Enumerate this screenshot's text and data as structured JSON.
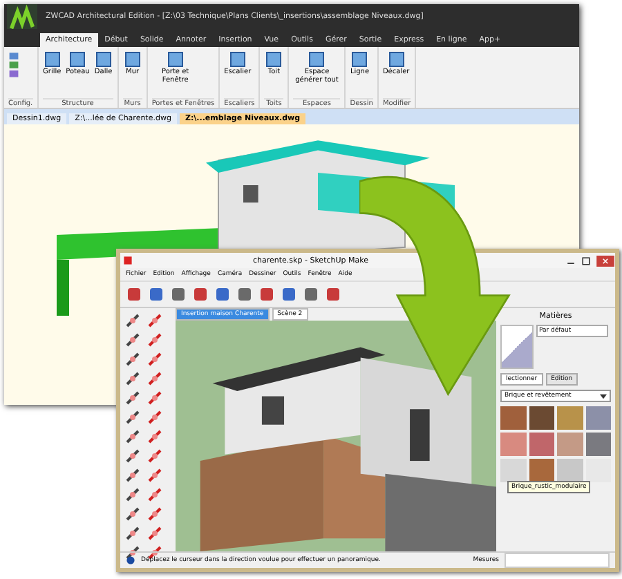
{
  "cad_window": {
    "title": "ZWCAD Architectural Edition - [Z:\\03 Technique\\Plans Clients\\_insertions\\assemblage Niveaux.dwg]",
    "tabs": [
      {
        "label": "Architecture",
        "selected": true
      },
      {
        "label": "Début",
        "selected": false
      },
      {
        "label": "Solide",
        "selected": false
      },
      {
        "label": "Annoter",
        "selected": false
      },
      {
        "label": "Insertion",
        "selected": false
      },
      {
        "label": "Vue",
        "selected": false
      },
      {
        "label": "Outils",
        "selected": false
      },
      {
        "label": "Gérer",
        "selected": false
      },
      {
        "label": "Sortie",
        "selected": false
      },
      {
        "label": "Express",
        "selected": false
      },
      {
        "label": "En ligne",
        "selected": false
      },
      {
        "label": "App+",
        "selected": false
      }
    ],
    "ribbon_groups": [
      {
        "label": "Config."
      },
      {
        "label": "Structure",
        "buttons": [
          "Grille",
          "Poteau",
          "Dalle"
        ]
      },
      {
        "label": "Murs",
        "buttons": [
          "Mur"
        ]
      },
      {
        "label": "Portes et Fenêtres",
        "buttons": [
          "Porte et Fenêtre"
        ]
      },
      {
        "label": "Escaliers",
        "buttons": [
          "Escalier"
        ]
      },
      {
        "label": "Toits",
        "buttons": [
          "Toit"
        ]
      },
      {
        "label": "Espaces",
        "buttons": [
          "Espace générer tout"
        ]
      },
      {
        "label": "Dessin",
        "buttons": [
          "Ligne"
        ]
      },
      {
        "label": "Modifier",
        "buttons": [
          "Décaler"
        ]
      }
    ],
    "documents": [
      {
        "label": "Dessin1.dwg",
        "selected": false
      },
      {
        "label": "Z:\\...lée de Charente.dwg",
        "selected": false
      },
      {
        "label": "Z:\\...emblage Niveaux.dwg",
        "selected": true
      }
    ]
  },
  "sketchup_window": {
    "title": "charente.skp - SketchUp Make",
    "menu": [
      "Fichier",
      "Edition",
      "Affichage",
      "Caméra",
      "Dessiner",
      "Outils",
      "Fenêtre",
      "Aide"
    ],
    "scenes": [
      {
        "label": "Insertion maison Charente",
        "selected": true
      },
      {
        "label": "Scène 2",
        "selected": false
      }
    ],
    "materials": {
      "title": "Matières",
      "current": "Par défaut",
      "tabs": [
        {
          "label": "lectionner",
          "selected": true
        },
        {
          "label": "Edition",
          "selected": false
        }
      ],
      "library": "Brique et revêtement",
      "swatches": [
        {
          "color": "#a0603c"
        },
        {
          "color": "#6b4a32"
        },
        {
          "color": "#b8924a"
        },
        {
          "color": "#8c90a8"
        },
        {
          "color": "#d88a80"
        },
        {
          "color": "#c0666a"
        },
        {
          "color": "#c49a86"
        },
        {
          "color": "#7a7a80"
        },
        {
          "color": "#d8d8d8"
        },
        {
          "color": "#a8683c"
        },
        {
          "color": "#c8c8c8"
        },
        {
          "color": "#e8e8e8"
        }
      ],
      "tooltip": "Brique_rustic_modulaire"
    },
    "status": "Déplacez le curseur dans la direction voulue pour effectuer un panoramique.",
    "measure_label": "Mesures"
  }
}
